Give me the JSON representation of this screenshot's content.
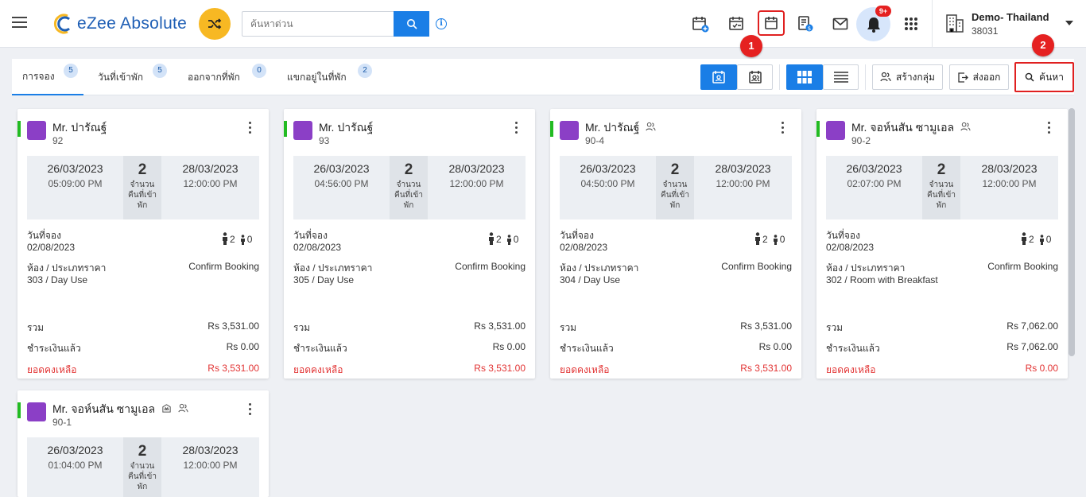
{
  "header": {
    "app_name": "eZee Absolute",
    "search_placeholder": "ค้นหาด่วน",
    "notification_count": "9+",
    "property_name": "Demo- Thailand",
    "property_code": "38031",
    "callouts": [
      "1",
      "2"
    ],
    "icons": [
      "new-reservation-icon",
      "checkin-list-icon",
      "calendar-icon",
      "billing-icon",
      "mail-icon",
      "bell-icon",
      "apps-icon",
      "hotel-icon"
    ]
  },
  "toolbar": {
    "tabs": [
      {
        "label": "การจอง",
        "count": "5"
      },
      {
        "label": "วันที่เข้าพัก",
        "count": "5"
      },
      {
        "label": "ออกจากที่พัก",
        "count": "0"
      },
      {
        "label": "แขกอยู่ในที่พัก",
        "count": "2"
      }
    ],
    "create_group_label": "สร้างกลุ่ม",
    "export_label": "ส่งออก",
    "search_label": "ค้นหา"
  },
  "labels": {
    "nights": "จำนวนคืนที่เข้าพัก",
    "booking_date": "วันที่จอง",
    "room_rate": "ห้อง / ประเภทราคา",
    "total": "รวม",
    "paid": "ชำระเงินแล้ว",
    "balance": "ยอดคงเหลือ"
  },
  "cards": [
    {
      "guest": "Mr. ปารัณฐ์",
      "res_no": "92",
      "arrival_date": "26/03/2023",
      "arrival_time": "05:09:00 PM",
      "nights": "2",
      "departure_date": "28/03/2023",
      "departure_time": "12:00:00 PM",
      "booking_date": "02/08/2023",
      "adults": "2",
      "children": "0",
      "status": "Confirm Booking",
      "room_rate": "303 / Day Use",
      "total": "Rs 3,531.00",
      "paid": "Rs 0.00",
      "balance": "Rs 3,531.00"
    },
    {
      "guest": "Mr. ปารัณฐ์",
      "res_no": "93",
      "arrival_date": "26/03/2023",
      "arrival_time": "04:56:00 PM",
      "nights": "2",
      "departure_date": "28/03/2023",
      "departure_time": "12:00:00 PM",
      "booking_date": "02/08/2023",
      "adults": "2",
      "children": "0",
      "status": "Confirm Booking",
      "room_rate": "305 / Day Use",
      "total": "Rs 3,531.00",
      "paid": "Rs 0.00",
      "balance": "Rs 3,531.00"
    },
    {
      "guest": "Mr. ปารัณฐ์",
      "res_no": "90-4",
      "arrival_date": "26/03/2023",
      "arrival_time": "04:50:00 PM",
      "nights": "2",
      "departure_date": "28/03/2023",
      "departure_time": "12:00:00 PM",
      "booking_date": "02/08/2023",
      "adults": "2",
      "children": "0",
      "status": "Confirm Booking",
      "room_rate": "304 / Day Use",
      "total": "Rs 3,531.00",
      "paid": "Rs 0.00",
      "balance": "Rs 3,531.00"
    },
    {
      "guest": "Mr. จอห์นสัน ซามูเอล",
      "res_no": "90-2",
      "arrival_date": "26/03/2023",
      "arrival_time": "02:07:00 PM",
      "nights": "2",
      "departure_date": "28/03/2023",
      "departure_time": "12:00:00 PM",
      "booking_date": "02/08/2023",
      "adults": "2",
      "children": "0",
      "status": "Confirm Booking",
      "room_rate": "302 / Room with Breakfast",
      "total": "Rs 7,062.00",
      "paid": "Rs 7,062.00",
      "balance": "Rs 0.00"
    },
    {
      "guest": "Mr. จอห์นสัน ซามูเอล",
      "res_no": "90-1",
      "arrival_date": "26/03/2023",
      "arrival_time": "01:04:00 PM",
      "nights": "2",
      "departure_date": "28/03/2023",
      "departure_time": "12:00:00 PM"
    }
  ],
  "colors": {
    "accent": "#1a7ee6",
    "room_icon": "#8b3fc6",
    "status_green": "#22bb22",
    "balance_red": "#e23333",
    "highlight": "#e02020"
  }
}
